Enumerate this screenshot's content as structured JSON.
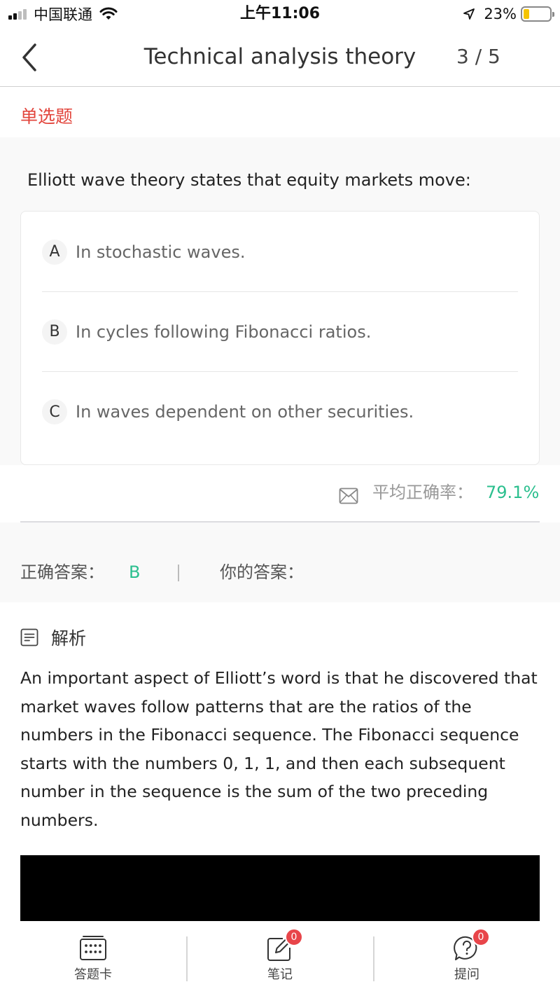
{
  "status_bar": {
    "carrier": "中国联通",
    "time": "上午11:06",
    "battery_percent": "23%",
    "battery_level": 0.23,
    "icons": [
      "signal-icon",
      "wifi-icon",
      "location-arrow-icon",
      "battery-icon"
    ]
  },
  "nav": {
    "back_icon": "chevron-left-icon",
    "title": "Technical analysis theory",
    "counter": "3 / 5"
  },
  "question": {
    "type": "单选题",
    "text": "Elliott wave theory states that equity markets move:",
    "options": [
      {
        "letter": "A",
        "text": "In stochastic waves."
      },
      {
        "letter": "B",
        "text": "In cycles following Fibonacci ratios."
      },
      {
        "letter": "C",
        "text": "In waves dependent on other securities."
      }
    ]
  },
  "stats": {
    "icon": "mail-icon",
    "avg_label": "平均正确率：",
    "avg_value": "79.1%"
  },
  "answer": {
    "correct_label": "正确答案：",
    "correct_value": "B",
    "yours_label": "你的答案："
  },
  "analysis": {
    "icon": "document-icon",
    "title": "解析",
    "text": "An important aspect of Elliott’s word is that he discovered that market waves follow patterns that are the ratios of the numbers in the Fibonacci sequence. The Fibonacci sequence starts with the numbers 0, 1, 1, and then each subsequent number in the sequence is the sum of the two preceding numbers."
  },
  "tab_bar": {
    "tabs": [
      {
        "label": "答题卡",
        "icon": "answer-card-icon",
        "badge": null
      },
      {
        "label": "笔记",
        "icon": "note-edit-icon",
        "badge": "0"
      },
      {
        "label": "提问",
        "icon": "question-bubble-icon",
        "badge": "0"
      }
    ]
  },
  "colors": {
    "accent_red": "#e2453c",
    "accent_green": "#2bbf8e",
    "badge_red": "#e8454a",
    "battery_yellow": "#f5c400"
  }
}
